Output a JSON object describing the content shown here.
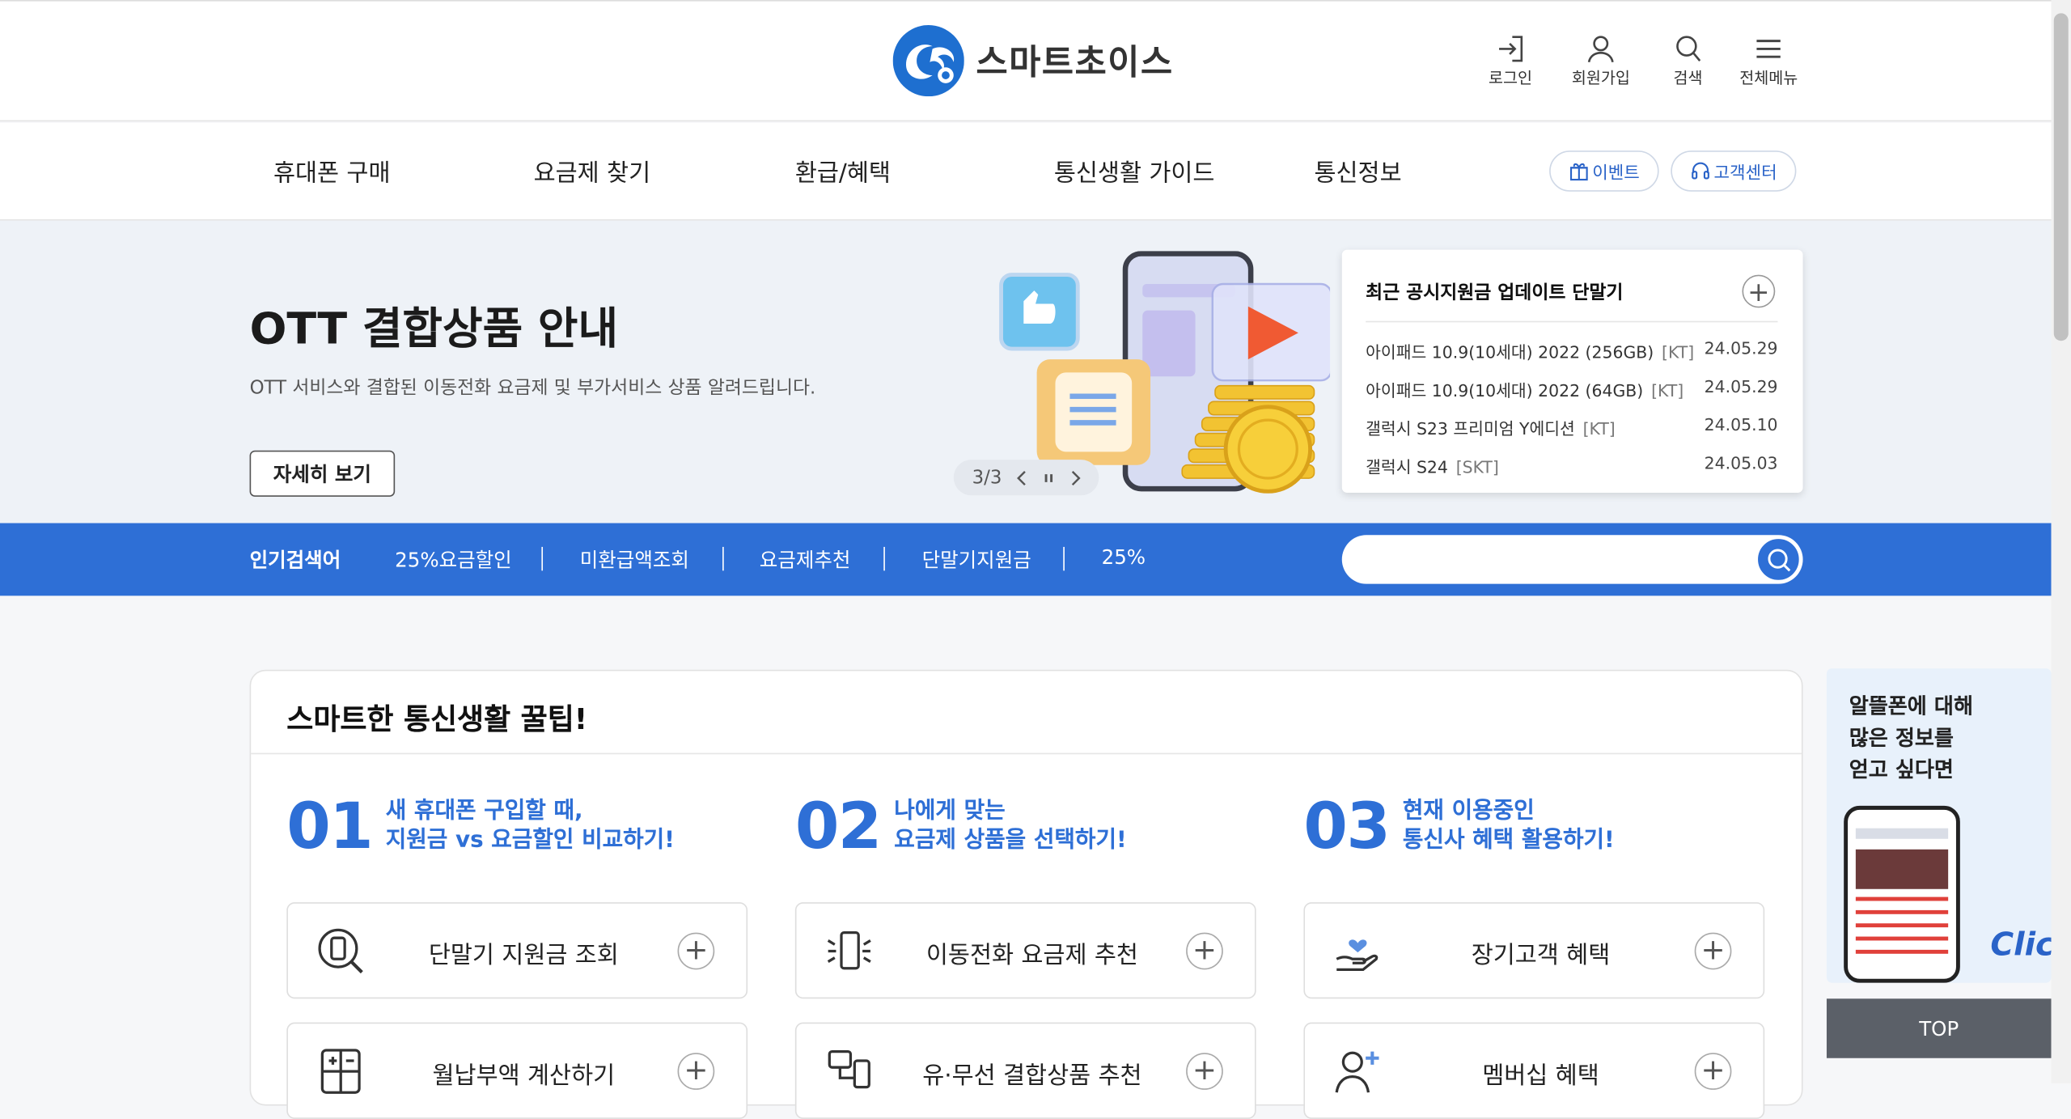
{
  "header": {
    "brand": "스마트초이스",
    "utils": [
      {
        "label": "로그인",
        "icon": "login-icon"
      },
      {
        "label": "회원가입",
        "icon": "user-icon"
      },
      {
        "label": "검색",
        "icon": "search-icon"
      },
      {
        "label": "전체메뉴",
        "icon": "menu-icon"
      }
    ]
  },
  "nav": {
    "items": [
      "휴대폰 구매",
      "요금제 찾기",
      "환급/혜택",
      "통신생활 가이드",
      "통신정보"
    ],
    "pills": [
      {
        "label": "이벤트",
        "icon": "gift-icon"
      },
      {
        "label": "고객센터",
        "icon": "headset-icon"
      }
    ]
  },
  "hero": {
    "title": "OTT 결합상품 안내",
    "desc": "OTT 서비스와 결합된 이동전화 요금제 및 부가서비스 상품 알려드립니다.",
    "button": "자세히 보기",
    "pager": "3/3"
  },
  "notice": {
    "title": "최근 공시지원금 업데이트 단말기",
    "rows": [
      {
        "name": "아이패드 10.9(10세대) 2022 (256GB)",
        "tag": "[KT]",
        "date": "24.05.29"
      },
      {
        "name": "아이패드 10.9(10세대) 2022 (64GB)",
        "tag": "[KT]",
        "date": "24.05.29"
      },
      {
        "name": "갤럭시 S23 프리미엄 Y에디션",
        "tag": "[KT]",
        "date": "24.05.10"
      },
      {
        "name": "갤럭시 S24",
        "tag": "[SKT]",
        "date": "24.05.03"
      }
    ]
  },
  "popular": {
    "label": "인기검색어",
    "keywords": [
      "25%요금할인",
      "미환급액조회",
      "요금제추천",
      "단말기지원금",
      "25%"
    ]
  },
  "tips": {
    "title": "스마트한 통신생활 꿀팁!",
    "columns": [
      {
        "num": "01",
        "line1": "새 휴대폰 구입할 때,",
        "line2": "지원금 vs 요금할인 비교하기!",
        "cards": [
          {
            "label": "단말기 지원금 조회",
            "icon": "phone-search-icon"
          },
          {
            "label": "월납부액 계산하기",
            "icon": "calculator-icon"
          }
        ]
      },
      {
        "num": "02",
        "line1": "나에게 맞는",
        "line2": "요금제 상품을 선택하기!",
        "cards": [
          {
            "label": "이동전화 요금제 추천",
            "icon": "mobile-plan-icon"
          },
          {
            "label": "유·무선 결합상품 추천",
            "icon": "bundle-icon"
          }
        ]
      },
      {
        "num": "03",
        "line1": "현재 이용중인",
        "line2": "통신사 혜택 활용하기!",
        "cards": [
          {
            "label": "장기고객 혜택",
            "icon": "heart-hand-icon"
          },
          {
            "label": "멤버십 혜택",
            "icon": "add-user-icon"
          }
        ]
      }
    ]
  },
  "side": {
    "line1": "알뜰폰에 대해",
    "line2": "많은 정보를",
    "line3": "얻고 싶다면",
    "click": "Click",
    "top": "TOP"
  },
  "colors": {
    "accent": "#2e6fd6",
    "hero_bg": "#eef2f7",
    "top_button": "#5b6068"
  }
}
